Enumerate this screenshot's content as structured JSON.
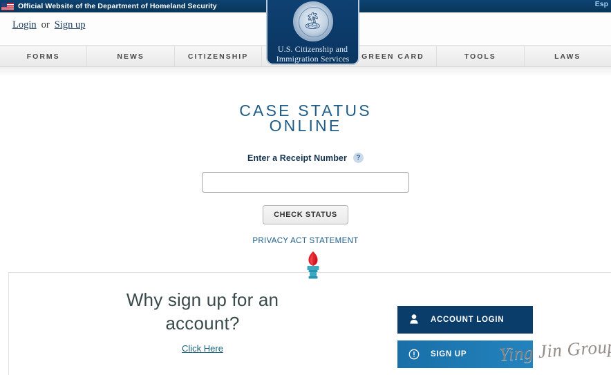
{
  "banner": {
    "text": "Official Website of the Department of Homeland Security",
    "flag_icon": "us-flag-icon",
    "espanol_label": "Esp",
    "background_color": "#0b3e6f"
  },
  "utility": {
    "login_label": "Login",
    "or_label": "or",
    "signup_label": "Sign up"
  },
  "logo": {
    "line1": "U.S. Citizenship and",
    "line2": "Immigration Services",
    "seal_icon": "dhs-seal-icon",
    "background_color": "#0f4377"
  },
  "nav": {
    "items": [
      {
        "label": "FORMS"
      },
      {
        "label": "NEWS"
      },
      {
        "label": "CITIZENSHIP"
      },
      {
        "label": "GREEN CARD"
      },
      {
        "label": "TOOLS"
      },
      {
        "label": "LAWS"
      }
    ]
  },
  "case_status": {
    "title_line1": "CASE STATUS",
    "title_line2": "ONLINE",
    "receipt_label": "Enter a Receipt Number",
    "help_icon_glyph": "?",
    "receipt_value": "",
    "receipt_placeholder": "",
    "check_button_label": "CHECK STATUS",
    "privacy_link_label": "PRIVACY ACT STATEMENT",
    "title_color": "#1f5c86"
  },
  "divider": {
    "torch_icon": "torch-icon",
    "flame_color": "#e0202a",
    "base_color": "#3aa9c4"
  },
  "bottom": {
    "why_title_line1": "Why sign up for an",
    "why_title_line2": "account?",
    "click_here_label": "Click Here",
    "buttons": [
      {
        "label": "ACCOUNT LOGIN",
        "icon": "person-icon",
        "color": "#0b3d6b"
      },
      {
        "label": "SIGN UP",
        "icon": "info-circle-icon",
        "color": "#2383bd"
      }
    ]
  },
  "watermark": {
    "text": "Ying Jin Group"
  }
}
